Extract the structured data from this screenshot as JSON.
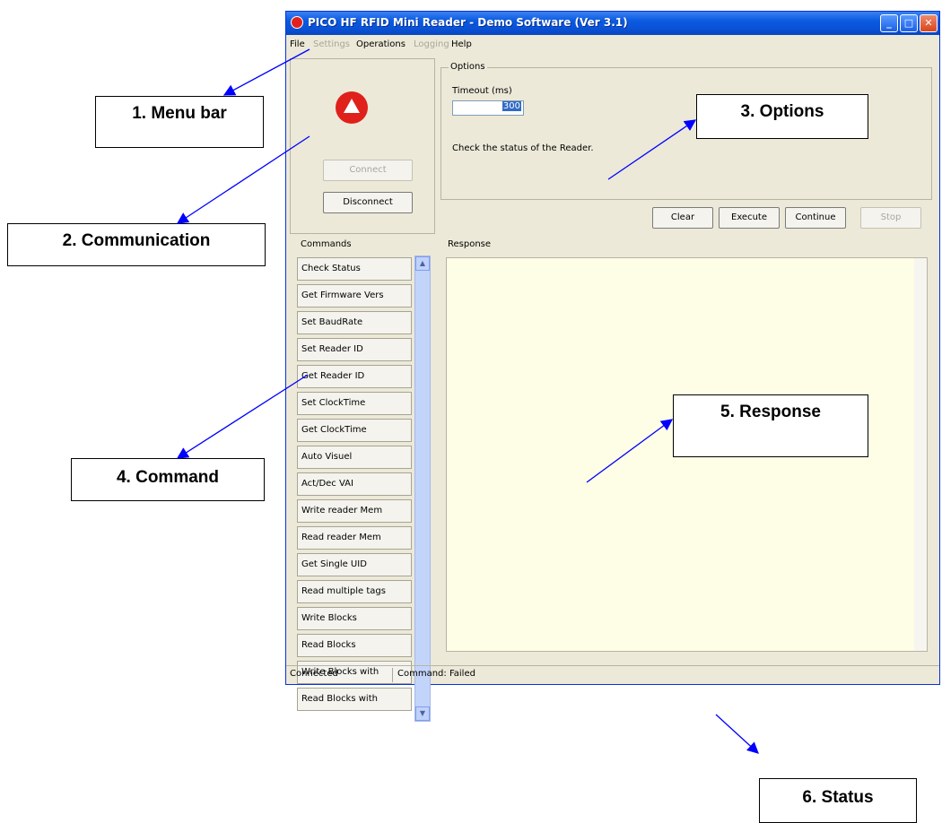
{
  "window": {
    "title": "PICO HF RFID Mini Reader - Demo Software (Ver 3.1)",
    "controls": {
      "minimize": "_",
      "maximize": "□",
      "close": "✕"
    }
  },
  "menu": [
    {
      "label": "File",
      "enabled": true
    },
    {
      "label": "Settings",
      "enabled": false
    },
    {
      "label": "Operations",
      "enabled": true
    },
    {
      "label": "Logging",
      "enabled": false
    },
    {
      "label": "Help",
      "enabled": true
    }
  ],
  "communication": {
    "connect_label": "Connect",
    "disconnect_label": "Disconnect"
  },
  "options": {
    "group_label": "Options",
    "timeout_label": "Timeout (ms)",
    "timeout_value": "300",
    "description": "Check the status of the Reader."
  },
  "actions": {
    "clear": "Clear",
    "execute": "Execute",
    "continue": "Continue",
    "stop": "Stop"
  },
  "commands": {
    "group_label": "Commands",
    "items": [
      "Check Status",
      "Get Firmware Vers",
      "Set BaudRate",
      "Set Reader ID",
      "Get Reader ID",
      "Set ClockTime",
      "Get ClockTime",
      "Auto Visuel",
      "Act/Dec VAI",
      "Write reader Mem",
      "Read reader Mem",
      "Get Single UID",
      "Read multiple tags",
      "Write Blocks",
      "Read Blocks",
      "Write Blocks with",
      "Read Blocks with"
    ]
  },
  "response": {
    "group_label": "Response"
  },
  "status": {
    "connection": "Connected",
    "command": "Command: Failed"
  },
  "callouts": {
    "menu_bar": "1. Menu bar",
    "communication": "2. Communication",
    "options": "3. Options",
    "command": "4. Command",
    "response": "5. Response",
    "status": "6. Status"
  },
  "colors": {
    "title_bar": "#0a53d8",
    "response_bg": "#fefde6",
    "arrow": "#0000ff",
    "logo": "#e0201b"
  }
}
